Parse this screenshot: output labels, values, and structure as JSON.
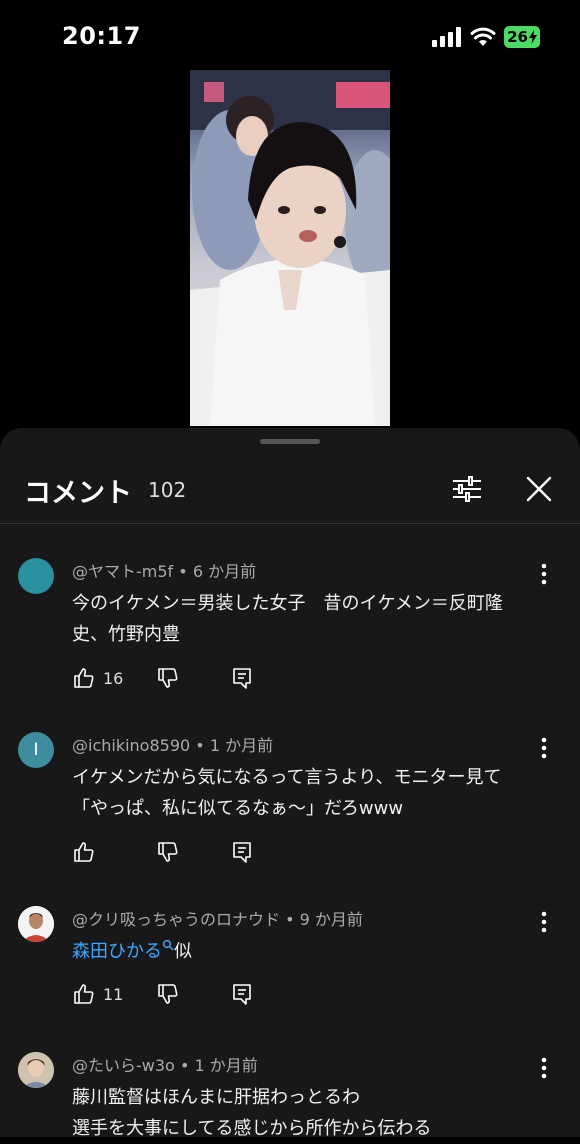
{
  "status_bar": {
    "time": "20:17",
    "battery": "26",
    "icons": [
      "signal-icon",
      "wifi-icon",
      "battery-icon"
    ]
  },
  "video": {
    "icon": "video-thumbnail"
  },
  "comments_panel": {
    "title": "コメント",
    "count": "102",
    "icons": [
      "filter-icon",
      "close-icon"
    ],
    "comments": [
      {
        "author": "@ヤマト-m5f",
        "time": "6 か月前",
        "text": "今のイケメン＝男装した女子　昔のイケメン＝反町隆史、竹野内豊",
        "likes": "16",
        "avatar_initial": "",
        "avatar_color": "#2a8f9e"
      },
      {
        "author": "@ichikino8590",
        "time": "1 か月前",
        "text": "イケメンだから気になるって言うより、モニター見て「やっぱ、私に似てるなぁ～」だろwww",
        "likes": "",
        "avatar_initial": "I",
        "avatar_color": "#3d8d9e"
      },
      {
        "author": "@クリ吸っちゃうのロナウド",
        "time": "9 か月前",
        "mention": "森田ひかる",
        "text": "似",
        "likes": "11",
        "avatar_initial": "",
        "avatar_color": "#ffffff"
      },
      {
        "author": "@たいら-w3o",
        "time": "1 か月前",
        "text_line1": "藤川監督はほんまに肝据わっとるわ",
        "text_line2": "選手を大事にしてる感じから所作から伝わる",
        "likes": "",
        "avatar_initial": "",
        "avatar_color": "#b9a58c"
      }
    ]
  },
  "colors": {
    "background": "#000000",
    "sheet": "#181818",
    "link": "#3ea6ff",
    "battery": "#4cd964"
  }
}
